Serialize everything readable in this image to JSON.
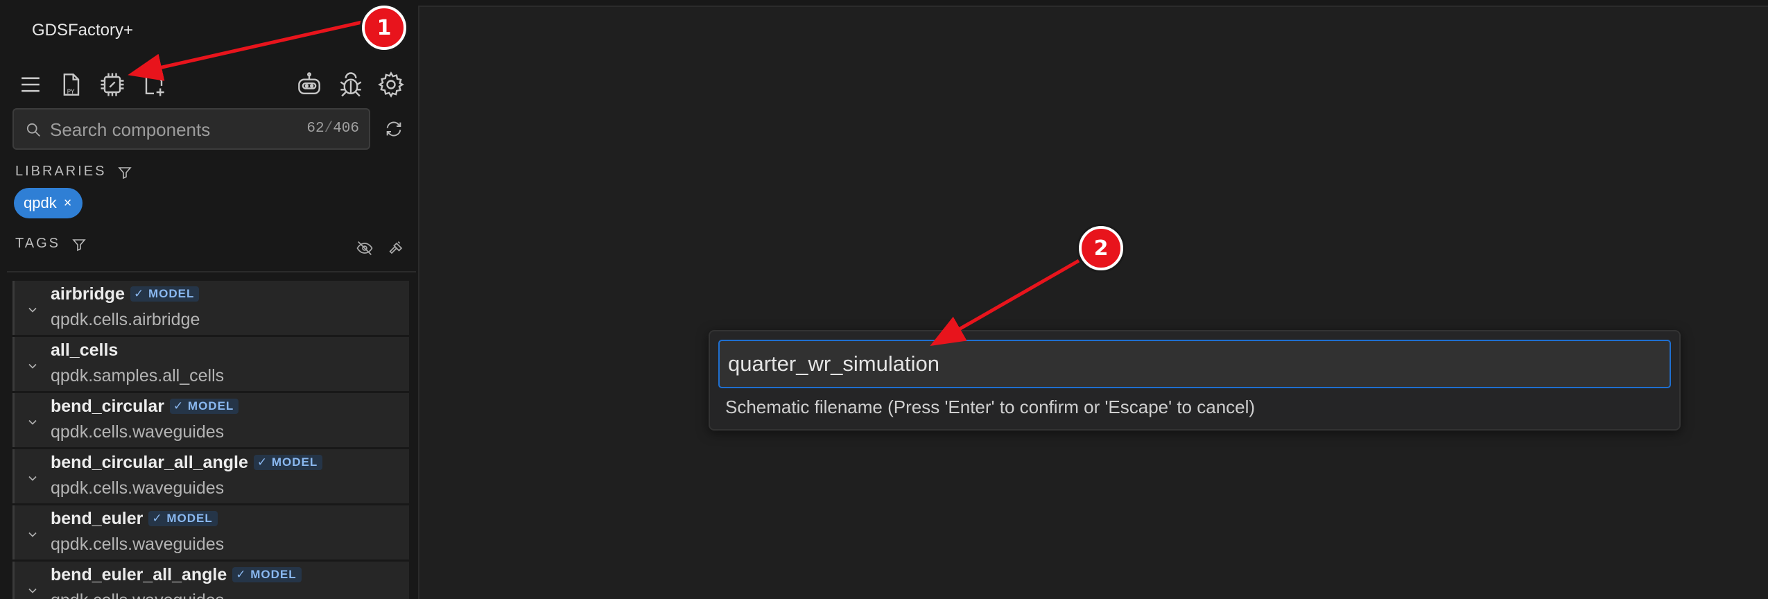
{
  "app": {
    "title": "GDSFactory+"
  },
  "toolbar": {
    "icons": [
      "menu-icon",
      "python-file-icon",
      "chip-edit-icon",
      "add-file-icon",
      "robot-icon",
      "bug-icon",
      "gear-icon"
    ]
  },
  "search": {
    "placeholder": "Search components",
    "count_shown": "62",
    "count_sep": "/",
    "count_total": "406"
  },
  "libraries": {
    "label": "LIBRARIES",
    "chips": [
      {
        "label": "qpdk",
        "remove": "×"
      }
    ]
  },
  "tags": {
    "label": "TAGS"
  },
  "components": [
    {
      "name": "airbridge",
      "module": "qpdk.cells.airbridge",
      "badge": "MODEL"
    },
    {
      "name": "all_cells",
      "module": "qpdk.samples.all_cells",
      "badge": ""
    },
    {
      "name": "bend_circular",
      "module": "qpdk.cells.waveguides",
      "badge": "MODEL"
    },
    {
      "name": "bend_circular_all_angle",
      "module": "qpdk.cells.waveguides",
      "badge": "MODEL"
    },
    {
      "name": "bend_euler",
      "module": "qpdk.cells.waveguides",
      "badge": "MODEL"
    },
    {
      "name": "bend_euler_all_angle",
      "module": "qpdk.cells.waveguides",
      "badge": "MODEL"
    }
  ],
  "quick_input": {
    "value": "quarter_wr_simulation",
    "hint": "Schematic filename (Press 'Enter' to confirm or 'Escape' to cancel)"
  },
  "annotations": {
    "marker_1": "1",
    "marker_2": "2",
    "arrow_color": "#e8141c"
  },
  "colors": {
    "accent": "#2f7fd5",
    "badge_text": "#8ab8f0",
    "focus_border": "#1f6fd0"
  }
}
